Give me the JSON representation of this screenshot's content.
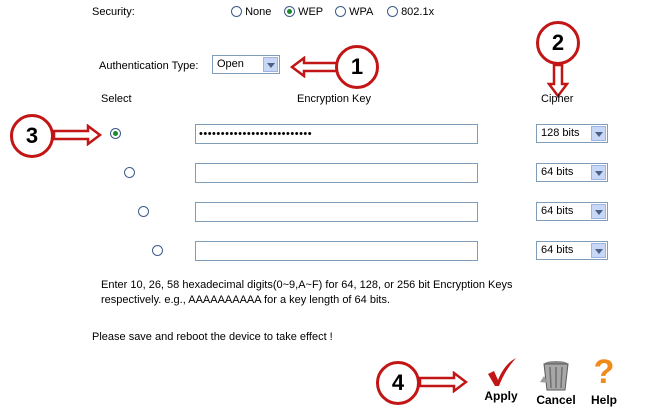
{
  "security": {
    "label": "Security:",
    "options": [
      "None",
      "WEP",
      "WPA",
      "802.1x"
    ],
    "selected": "WEP"
  },
  "auth": {
    "label": "Authentication Type:",
    "value": "Open"
  },
  "table": {
    "col_select": "Select",
    "col_key": "Encryption Key",
    "col_cipher": "Cipher",
    "rows": [
      {
        "selected": true,
        "key": "••••••••••••••••••••••••••",
        "cipher": "128 bits"
      },
      {
        "selected": false,
        "key": "",
        "cipher": "64 bits"
      },
      {
        "selected": false,
        "key": "",
        "cipher": "64 bits"
      },
      {
        "selected": false,
        "key": "",
        "cipher": "64 bits"
      }
    ]
  },
  "help_text": {
    "line1": "Enter 10, 26, 58 hexadecimal digits(0~9,A~F) for 64, 128, or 256 bit Encryption Keys",
    "line2": "respectively. e.g., AAAAAAAAAA for a key length of 64 bits."
  },
  "reboot_note": "Please save and reboot the device to take effect !",
  "buttons": {
    "apply": "Apply",
    "cancel": "Cancel",
    "help": "Help"
  },
  "callouts": [
    "1",
    "2",
    "3",
    "4"
  ],
  "colors": {
    "callout_red": "#c21515",
    "accent_green": "#1a8a2a"
  }
}
